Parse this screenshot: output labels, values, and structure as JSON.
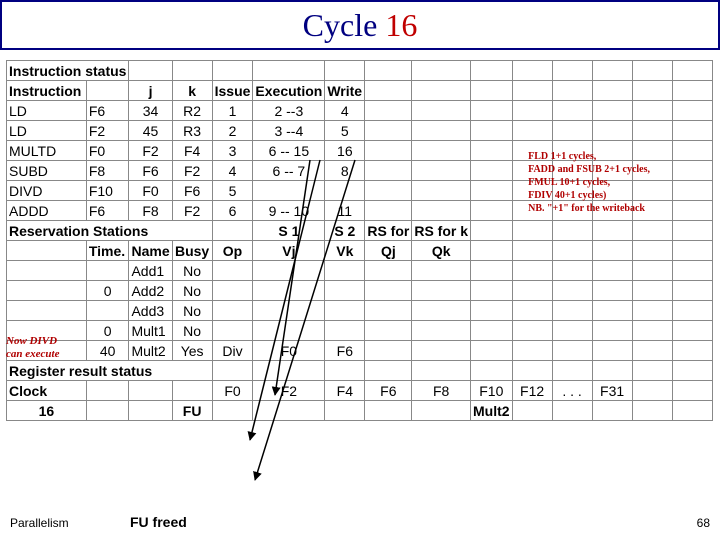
{
  "title": {
    "w1": "Cycle",
    "w2": "16"
  },
  "notes": [
    "FLD 1+1 cycles,",
    "FADD and FSUB 2+1 cycles,",
    "FMUL 10+1 cycles,",
    "FDIV 40+1 cycles)",
    "NB. \"+1\" for the writeback"
  ],
  "side_note": {
    "l1": "Now DIVD",
    "l2": "can execute"
  },
  "footer": {
    "left": "Parallelism",
    "center": "FU freed",
    "right": "68"
  },
  "hdr": {
    "status": "Instruction status",
    "instr": "Instruction",
    "j": "j",
    "k": "k",
    "issue": "Issue",
    "exec": "Execution",
    "write": "Write",
    "res": "Reservation Stations",
    "s1": "S 1",
    "s2": "S 2",
    "rsj": "RS for",
    "rsk": "RS for k",
    "time": "Time.",
    "name": "Name",
    "busy": "Busy",
    "op": "Op",
    "vj": "Vj",
    "vk": "Vk",
    "qj": "Qj",
    "qk": "Qk",
    "reg": "Register result status",
    "clock": "Clock",
    "fu": "FU"
  },
  "instr": [
    {
      "op": "LD",
      "d": "F6",
      "j": "34",
      "k": "R2",
      "is": "1",
      "ex": "2 --3",
      "wr": "4"
    },
    {
      "op": "LD",
      "d": "F2",
      "j": "45",
      "k": "R3",
      "is": "2",
      "ex": "3 --4",
      "wr": "5"
    },
    {
      "op": "MULTD",
      "d": "F0",
      "j": "F2",
      "k": "F4",
      "is": "3",
      "ex": "6 -- 15",
      "wr": "16"
    },
    {
      "op": "SUBD",
      "d": "F8",
      "j": "F6",
      "k": "F2",
      "is": "4",
      "ex": "6 -- 7",
      "wr": "8"
    },
    {
      "op": "DIVD",
      "d": "F10",
      "j": "F0",
      "k": "F6",
      "is": "5",
      "ex": "",
      "wr": ""
    },
    {
      "op": "ADDD",
      "d": "F6",
      "j": "F8",
      "k": "F2",
      "is": "6",
      "ex": "9 -- 10",
      "wr": "11"
    }
  ],
  "rs": [
    {
      "t": "",
      "n": "Add1",
      "b": "No",
      "op": "",
      "vj": "",
      "vk": "",
      "qj": "",
      "qk": ""
    },
    {
      "t": "0",
      "n": "Add2",
      "b": "No",
      "op": "",
      "vj": "",
      "vk": "",
      "qj": "",
      "qk": ""
    },
    {
      "t": "",
      "n": "Add3",
      "b": "No",
      "op": "",
      "vj": "",
      "vk": "",
      "qj": "",
      "qk": ""
    },
    {
      "t": "0",
      "n": "Mult1",
      "b": "No",
      "op": "",
      "vj": "",
      "vk": "",
      "qj": "",
      "qk": ""
    },
    {
      "t": "40",
      "n": "Mult2",
      "b": "Yes",
      "op": "Div",
      "vj": "F0",
      "vk": "F6",
      "qj": "",
      "qk": ""
    }
  ],
  "clock": "16",
  "reg": {
    "labels": [
      "F0",
      "F2",
      "F4",
      "F6",
      "F8",
      "F10",
      "F12",
      ". . .",
      "F31"
    ],
    "fu": [
      "",
      "",
      "",
      "",
      "",
      "Mult2",
      "",
      "",
      ""
    ]
  }
}
